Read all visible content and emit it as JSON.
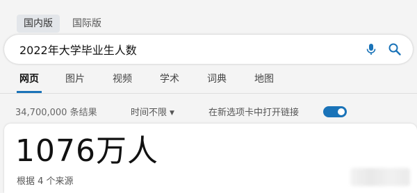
{
  "region_tabs": [
    {
      "label": "国内版",
      "active": true
    },
    {
      "label": "国际版",
      "active": false
    }
  ],
  "search": {
    "query": "2022年大学毕业生人数",
    "icons": [
      "microphone-icon",
      "search-icon"
    ],
    "accent": "#1a73b8"
  },
  "nav_tabs": [
    {
      "label": "网页",
      "active": true
    },
    {
      "label": "图片",
      "active": false
    },
    {
      "label": "视频",
      "active": false
    },
    {
      "label": "学术",
      "active": false
    },
    {
      "label": "词典",
      "active": false
    },
    {
      "label": "地图",
      "active": false
    }
  ],
  "filters": {
    "result_count": "34,700,000 条结果",
    "time_filter": "时间不限",
    "new_tab_label": "在新选项卡中打开链接",
    "new_tab_toggle_on": true
  },
  "answer": {
    "value": "1076万人",
    "source": "根据 4 个来源"
  }
}
